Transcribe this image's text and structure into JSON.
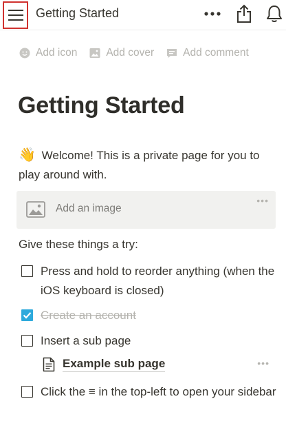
{
  "topbar": {
    "title": "Getting Started",
    "menu_icon": "hamburger-menu-icon",
    "more_icon": "more-horizontal-icon",
    "share_icon": "share-icon",
    "notifications_icon": "bell-icon",
    "highlight_color": "#d0322f"
  },
  "page_actions": [
    {
      "label": "Add icon",
      "icon": "smiley-icon"
    },
    {
      "label": "Add cover",
      "icon": "image-icon"
    },
    {
      "label": "Add comment",
      "icon": "comment-icon"
    }
  ],
  "page": {
    "title": "Getting Started",
    "welcome_emoji": "👋",
    "welcome_text": "Welcome! This is a private page for you to play around with.",
    "image_block_label": "Add an image",
    "block_menu_glyph": "•••",
    "prompt": "Give these things a try:"
  },
  "todos": [
    {
      "text": "Press and hold to reorder anything (when the iOS keyboard is closed)",
      "checked": false
    },
    {
      "text": "Create an account",
      "checked": true
    },
    {
      "text": "Insert a sub page",
      "checked": false
    },
    {
      "text": "Click the ≡ in the top-left to open your sidebar",
      "checked": false
    }
  ],
  "subpage": {
    "label": "Example sub page",
    "icon": "page-icon"
  },
  "colors": {
    "accent_check": "#2eaadc",
    "text": "#37352f",
    "muted": "#b4b3ae",
    "image_block_bg": "#f1f1ef"
  }
}
